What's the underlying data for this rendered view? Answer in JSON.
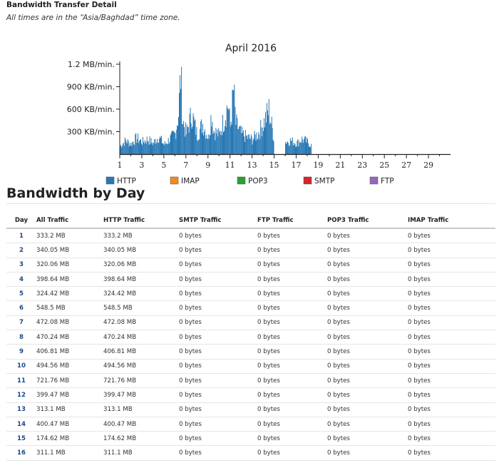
{
  "header": {
    "title": "Bandwidth Transfer Detail",
    "note": "All times are in the “Asia/Baghdad” time zone."
  },
  "colors": {
    "http": "#2878b5",
    "imap": "#f28a1c",
    "pop3": "#2ca02c",
    "smtp": "#d62728",
    "ftp": "#9467bd"
  },
  "chart_data": {
    "type": "area",
    "title": "April 2016",
    "xlabel": "",
    "ylabel": "",
    "xlim": [
      1,
      31
    ],
    "ylim": [
      0,
      1.2
    ],
    "y_unit": "MB/min.",
    "x_ticks": [
      "1",
      "3",
      "5",
      "7",
      "9",
      "11",
      "13",
      "15",
      "17",
      "19",
      "21",
      "23",
      "25",
      "27",
      "29"
    ],
    "y_ticks": [
      "300 KB/min.",
      "600 KB/min.",
      "900 KB/min.",
      "1.2 MB/min."
    ],
    "y_tick_values": [
      0.3,
      0.6,
      0.9,
      1.2
    ],
    "grid": false,
    "legend_position": "bottom",
    "legend": [
      "HTTP",
      "IMAP",
      "POP3",
      "SMTP",
      "FTP"
    ],
    "series": [
      {
        "name": "HTTP",
        "x": [
          1,
          1.5,
          2,
          2.5,
          3,
          3.5,
          4,
          4.5,
          5,
          5.5,
          6,
          6.3,
          6.5,
          6.7,
          7,
          7.5,
          8,
          8.5,
          9,
          9.3,
          9.5,
          10,
          10.5,
          10.8,
          11,
          11.3,
          11.5,
          12,
          12.5,
          13,
          13.5,
          14,
          14.5,
          15,
          15.4,
          16,
          16.5,
          17,
          17.5,
          18,
          18.4
        ],
        "values": [
          0.12,
          0.2,
          0.15,
          0.24,
          0.18,
          0.22,
          0.16,
          0.26,
          0.14,
          0.22,
          0.3,
          0.6,
          1.18,
          0.5,
          0.3,
          0.6,
          0.28,
          0.45,
          0.24,
          0.6,
          0.35,
          0.28,
          0.55,
          0.75,
          0.4,
          0.95,
          0.45,
          0.3,
          0.25,
          0.22,
          0.3,
          0.45,
          0.65,
          0.2,
          0.0,
          0.18,
          0.2,
          0.16,
          0.22,
          0.18,
          0.12
        ]
      },
      {
        "name": "IMAP",
        "values": []
      },
      {
        "name": "POP3",
        "values": []
      },
      {
        "name": "SMTP",
        "values": []
      },
      {
        "name": "FTP",
        "values": []
      }
    ]
  },
  "section": {
    "title": "Bandwidth by Day"
  },
  "table": {
    "headers": [
      "Day",
      "All Traffic",
      "HTTP Traffic",
      "SMTP Traffic",
      "FTP Traffic",
      "POP3 Traffic",
      "IMAP Traffic"
    ],
    "rows": [
      [
        "1",
        "333.2 MB",
        "333.2 MB",
        "0 bytes",
        "0 bytes",
        "0 bytes",
        "0 bytes"
      ],
      [
        "2",
        "340.05 MB",
        "340.05 MB",
        "0 bytes",
        "0 bytes",
        "0 bytes",
        "0 bytes"
      ],
      [
        "3",
        "320.06 MB",
        "320.06 MB",
        "0 bytes",
        "0 bytes",
        "0 bytes",
        "0 bytes"
      ],
      [
        "4",
        "398.64 MB",
        "398.64 MB",
        "0 bytes",
        "0 bytes",
        "0 bytes",
        "0 bytes"
      ],
      [
        "5",
        "324.42 MB",
        "324.42 MB",
        "0 bytes",
        "0 bytes",
        "0 bytes",
        "0 bytes"
      ],
      [
        "6",
        "548.5 MB",
        "548.5 MB",
        "0 bytes",
        "0 bytes",
        "0 bytes",
        "0 bytes"
      ],
      [
        "7",
        "472.08 MB",
        "472.08 MB",
        "0 bytes",
        "0 bytes",
        "0 bytes",
        "0 bytes"
      ],
      [
        "8",
        "470.24 MB",
        "470.24 MB",
        "0 bytes",
        "0 bytes",
        "0 bytes",
        "0 bytes"
      ],
      [
        "9",
        "406.81 MB",
        "406.81 MB",
        "0 bytes",
        "0 bytes",
        "0 bytes",
        "0 bytes"
      ],
      [
        "10",
        "494.56 MB",
        "494.56 MB",
        "0 bytes",
        "0 bytes",
        "0 bytes",
        "0 bytes"
      ],
      [
        "11",
        "721.76 MB",
        "721.76 MB",
        "0 bytes",
        "0 bytes",
        "0 bytes",
        "0 bytes"
      ],
      [
        "12",
        "399.47 MB",
        "399.47 MB",
        "0 bytes",
        "0 bytes",
        "0 bytes",
        "0 bytes"
      ],
      [
        "13",
        "313.1 MB",
        "313.1 MB",
        "0 bytes",
        "0 bytes",
        "0 bytes",
        "0 bytes"
      ],
      [
        "14",
        "400.47 MB",
        "400.47 MB",
        "0 bytes",
        "0 bytes",
        "0 bytes",
        "0 bytes"
      ],
      [
        "15",
        "174.62 MB",
        "174.62 MB",
        "0 bytes",
        "0 bytes",
        "0 bytes",
        "0 bytes"
      ],
      [
        "16",
        "311.1 MB",
        "311.1 MB",
        "0 bytes",
        "0 bytes",
        "0 bytes",
        "0 bytes"
      ]
    ]
  }
}
